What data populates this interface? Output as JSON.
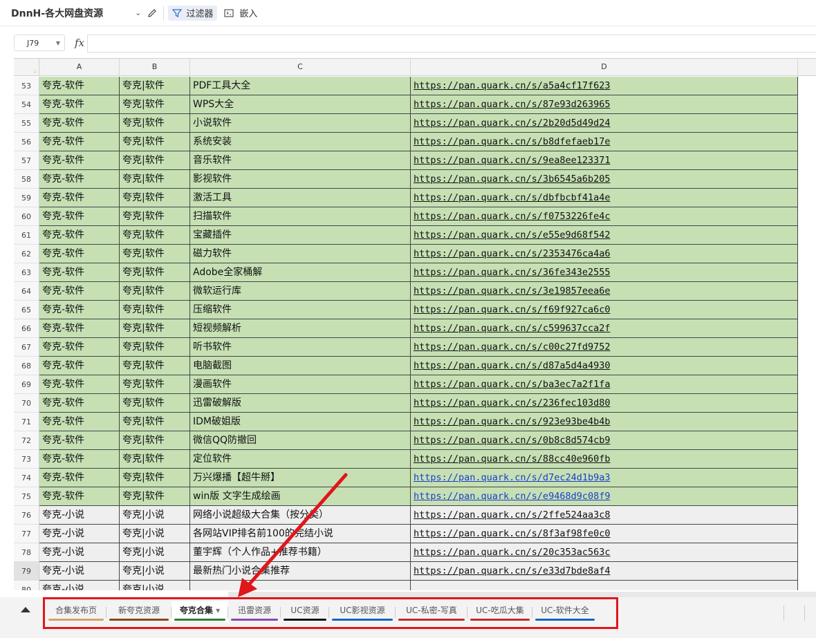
{
  "toolbar": {
    "doc_title": "DnnH-各大网盘资源",
    "filter_label": "过滤器",
    "embed_label": "嵌入"
  },
  "formula_bar": {
    "cell_ref": "J79",
    "fx_label": "fx",
    "formula_value": ""
  },
  "columns": [
    "A",
    "B",
    "C",
    "D"
  ],
  "active_row": "79",
  "rows": [
    {
      "n": "53",
      "a": "夸克-软件",
      "b": "夸克|软件",
      "c": "PDF工具大全",
      "d": "https://pan.quark.cn/s/a5a4cf17f623",
      "style": "green"
    },
    {
      "n": "54",
      "a": "夸克-软件",
      "b": "夸克|软件",
      "c": "WPS大全",
      "d": "https://pan.quark.cn/s/87e93d263965",
      "style": "green"
    },
    {
      "n": "55",
      "a": "夸克-软件",
      "b": "夸克|软件",
      "c": "小说软件",
      "d": "https://pan.quark.cn/s/2b20d5d49d24",
      "style": "green"
    },
    {
      "n": "56",
      "a": "夸克-软件",
      "b": "夸克|软件",
      "c": "系统安装",
      "d": "https://pan.quark.cn/s/b8dfefaeb17e",
      "style": "green"
    },
    {
      "n": "57",
      "a": "夸克-软件",
      "b": "夸克|软件",
      "c": "音乐软件",
      "d": "https://pan.quark.cn/s/9ea8ee123371",
      "style": "green"
    },
    {
      "n": "58",
      "a": "夸克-软件",
      "b": "夸克|软件",
      "c": "影视软件",
      "d": "https://pan.quark.cn/s/3b6545a6b205",
      "style": "green"
    },
    {
      "n": "59",
      "a": "夸克-软件",
      "b": "夸克|软件",
      "c": "激活工具",
      "d": "https://pan.quark.cn/s/dbfbcbf41a4e",
      "style": "green"
    },
    {
      "n": "60",
      "a": "夸克-软件",
      "b": "夸克|软件",
      "c": "扫描软件",
      "d": "https://pan.quark.cn/s/f0753226fe4c",
      "style": "green"
    },
    {
      "n": "61",
      "a": "夸克-软件",
      "b": "夸克|软件",
      "c": "宝藏插件",
      "d": "https://pan.quark.cn/s/e55e9d68f542",
      "style": "green"
    },
    {
      "n": "62",
      "a": "夸克-软件",
      "b": "夸克|软件",
      "c": "磁力软件",
      "d": "https://pan.quark.cn/s/2353476ca4a6",
      "style": "green"
    },
    {
      "n": "63",
      "a": "夸克-软件",
      "b": "夸克|软件",
      "c": "Adobe全家桶解",
      "d": "https://pan.quark.cn/s/36fe343e2555",
      "style": "green"
    },
    {
      "n": "64",
      "a": "夸克-软件",
      "b": "夸克|软件",
      "c": "微软运行库",
      "d": "https://pan.quark.cn/s/3e19857eea6e",
      "style": "green"
    },
    {
      "n": "65",
      "a": "夸克-软件",
      "b": "夸克|软件",
      "c": "压缩软件",
      "d": "https://pan.quark.cn/s/f69f927ca6c0",
      "style": "green"
    },
    {
      "n": "66",
      "a": "夸克-软件",
      "b": "夸克|软件",
      "c": "短视频解析",
      "d": "https://pan.quark.cn/s/c599637cca2f",
      "style": "green"
    },
    {
      "n": "67",
      "a": "夸克-软件",
      "b": "夸克|软件",
      "c": "听书软件",
      "d": "https://pan.quark.cn/s/c00c27fd9752",
      "style": "green"
    },
    {
      "n": "68",
      "a": "夸克-软件",
      "b": "夸克|软件",
      "c": "电脑截图",
      "d": "https://pan.quark.cn/s/d87a5d4a4930",
      "style": "green"
    },
    {
      "n": "69",
      "a": "夸克-软件",
      "b": "夸克|软件",
      "c": "漫画软件",
      "d": "https://pan.quark.cn/s/ba3ec7a2f1fa",
      "style": "green"
    },
    {
      "n": "70",
      "a": "夸克-软件",
      "b": "夸克|软件",
      "c": "迅雷破解版",
      "d": "https://pan.quark.cn/s/236fec103d80",
      "style": "green"
    },
    {
      "n": "71",
      "a": "夸克-软件",
      "b": "夸克|软件",
      "c": "IDM破姐版",
      "d": "https://pan.quark.cn/s/923e93be4b4b",
      "style": "green"
    },
    {
      "n": "72",
      "a": "夸克-软件",
      "b": "夸克|软件",
      "c": "微信QQ防撤回",
      "d": "https://pan.quark.cn/s/0b8c8d574cb9",
      "style": "green"
    },
    {
      "n": "73",
      "a": "夸克-软件",
      "b": "夸克|软件",
      "c": "定位软件",
      "d": "https://pan.quark.cn/s/88cc40e960fb",
      "style": "green"
    },
    {
      "n": "74",
      "a": "夸克-软件",
      "b": "夸克|软件",
      "c": "万兴爆播【超牛掰】",
      "d": "https://pan.quark.cn/s/d7ec24d1b9a3",
      "style": "green",
      "link": "blue"
    },
    {
      "n": "75",
      "a": "夸克-软件",
      "b": "夸克|软件",
      "c": "win版 文字生成绘画",
      "d": "https://pan.quark.cn/s/e9468d9c08f9",
      "style": "green",
      "link": "blue"
    },
    {
      "n": "76",
      "a": "夸克-小说",
      "b": "夸克|小说",
      "c": "网络小说超级大合集（按分类）",
      "d": "https://pan.quark.cn/s/2ffe524aa3c8",
      "style": "grey"
    },
    {
      "n": "77",
      "a": "夸克-小说",
      "b": "夸克|小说",
      "c": "各网站VIP排名前100的完结小说",
      "d": "https://pan.quark.cn/s/8f3af98fe0c0",
      "style": "grey"
    },
    {
      "n": "78",
      "a": "夸克-小说",
      "b": "夸克|小说",
      "c": "董宇辉（个人作品+推荐书籍）",
      "d": "https://pan.quark.cn/s/20c353ac563c",
      "style": "grey"
    },
    {
      "n": "79",
      "a": "夸克-小说",
      "b": "夸克|小说",
      "c": "最新热门小说合集推荐",
      "d": "https://pan.quark.cn/s/e33d7bde8af4",
      "style": "grey"
    },
    {
      "n": "80",
      "a": "夸克-小说",
      "b": "夸克|小说",
      "c": "",
      "d": "",
      "style": "grey"
    }
  ],
  "sheet_tabs": [
    {
      "label": "合集发布页",
      "color": "#d9a066",
      "active": false
    },
    {
      "label": "新夸克资源",
      "color": "#8b4513",
      "active": false
    },
    {
      "label": "夸克合集",
      "color": "#2e7d32",
      "active": true
    },
    {
      "label": "迅雷资源",
      "color": "#8e44ad",
      "active": false
    },
    {
      "label": "UC资源",
      "color": "#111111",
      "active": false
    },
    {
      "label": "UC影视资源",
      "color": "#1565c0",
      "active": false
    },
    {
      "label": "UC-私密-写真",
      "color": "#c62828",
      "active": false
    },
    {
      "label": "UC-吃瓜大集",
      "color": "#c62828",
      "active": false
    },
    {
      "label": "UC-软件大全",
      "color": "#1565c0",
      "active": false
    }
  ],
  "colors": {
    "row_green": "#c6e0b4",
    "row_grey": "#efefef",
    "annotation_red": "#e0161b",
    "link_blue": "#1a3ec9"
  }
}
